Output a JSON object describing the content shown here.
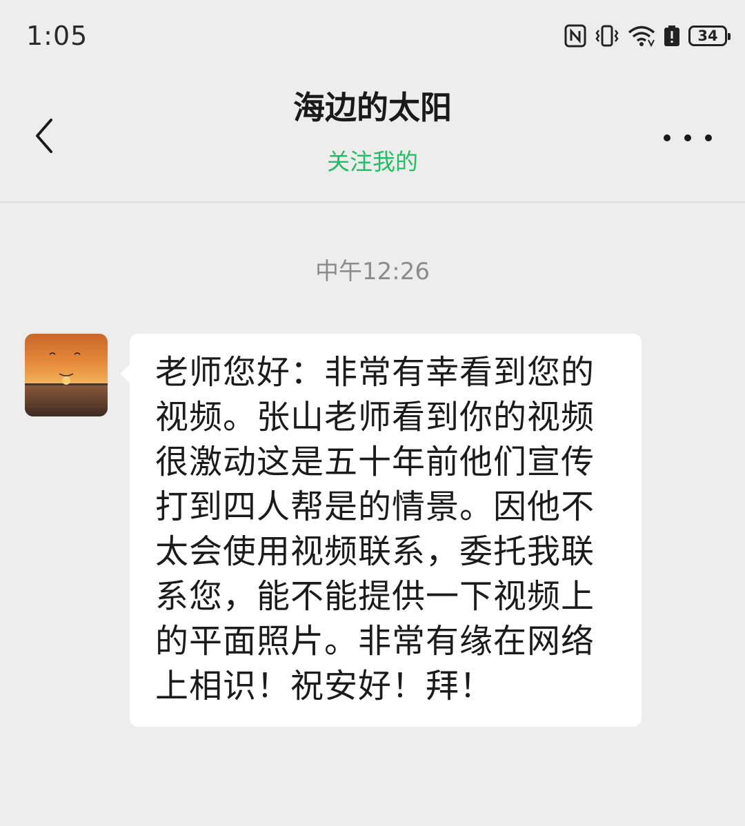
{
  "status_bar": {
    "time": "1:05",
    "battery_level": "34",
    "icons": [
      "nfc-icon",
      "vibrate-icon",
      "wifi-icon",
      "battery-saver-icon",
      "battery-icon"
    ]
  },
  "header": {
    "title": "海边的太阳",
    "subtitle": "关注我的",
    "back_icon": "chevron-left-icon",
    "more_icon": "more-horizontal-icon"
  },
  "chat": {
    "timestamp": "中午12:26",
    "messages": [
      {
        "sender_avatar": "sunset-avatar",
        "text": "老师您好：非常有幸看到您的视频。张山老师看到你的视频很激动这是五十年前他们宣传打到四人帮是的情景。因他不太会使用视频联系，委托我联系您，能不能提供一下视频上的平面照片。非常有缘在网络上相识！祝安好！拜！"
      }
    ]
  },
  "colors": {
    "background": "#ededed",
    "subtitle_green": "#1fbf62",
    "bubble": "#ffffff",
    "timestamp": "#8c8c8c"
  }
}
